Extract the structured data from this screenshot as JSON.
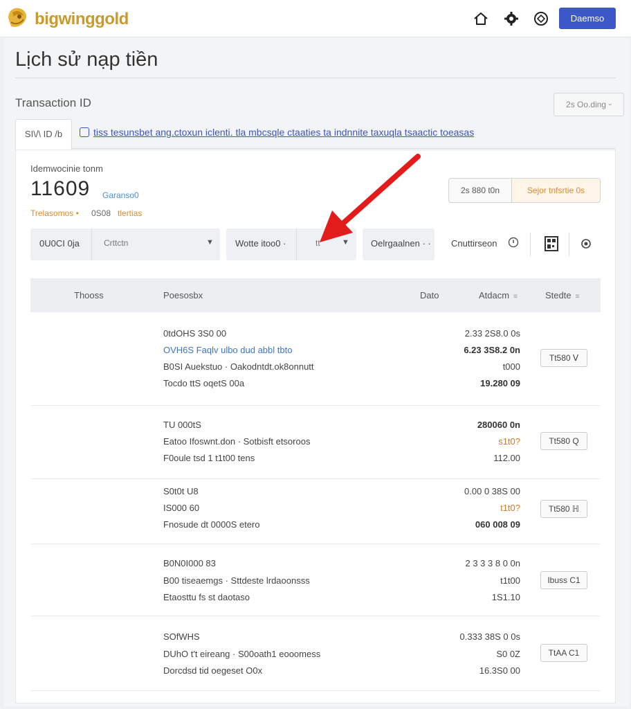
{
  "header": {
    "brand": "bigwinggold",
    "icons": [
      "home-icon",
      "settings-icon",
      "support-icon"
    ],
    "login_label": "Daemso"
  },
  "page": {
    "title": "Lịch sử nạp tiền",
    "txid_label": "Transaction ID",
    "txid_button": "2s Oo.ding ᵕ"
  },
  "tabs": {
    "active_label": "SI\\/\\ ID /b",
    "link_text": "tiss tesunsbet ang.ctoxun iclenti. tla mbcsqle ctaaties ta indnnite taxuqla tsaactic toeasas"
  },
  "balance": {
    "label": "Idemwocinie tonm",
    "value": "11609",
    "unit": "Garanso0",
    "sub_orange": "Trelasomos •",
    "sub_mid": "0S08",
    "sub_orange2": "tlertias"
  },
  "actions": {
    "grey_label": "2s 880 t0n",
    "orange_label": "Sejor tnfsrtie 0s"
  },
  "filters": {
    "date_label": "0U0CI 0ja",
    "date_value": "Crttctn",
    "method_label": "Wotte itoo0 ·",
    "method_value": "tt",
    "range_label": "Oelrgaalnen · ·",
    "search_label": "Cnuttirseon",
    "icons": [
      "info-icon",
      "qr-code-icon",
      "refresh-icon"
    ]
  },
  "table": {
    "columns": [
      "Thooss",
      "Poesosbx",
      "Dato",
      "Atdacm",
      "Stedte"
    ],
    "rows": [
      {
        "lines": [
          "0tdOHS 3S0 00",
          "OVH6S Faqlv ulbo dud abbl tbto",
          "B0SI Auekstuo  ·  Oakodntdt.ok8onnutt",
          "Tocdo ttS oqetS 00a"
        ],
        "amounts": [
          "2.33 2S8.0 0s",
          "6.23 3S8.2 0n",
          "t000",
          "19.280 09"
        ],
        "status": "Tt580 ᐯ"
      },
      {
        "lines": [
          "TU 000tS",
          "Eatoo Ifoswnt.don  ·  Sotbisft etsoroos",
          "F0oule tsd 1 t1t00 tens"
        ],
        "amounts": [
          "280060 0n",
          "s1t0?",
          "112.00"
        ],
        "status": "Tt580 Q"
      },
      {
        "lines": [
          "S0t0t U8",
          "IS000 60",
          "Fnosude dt 0000S etero"
        ],
        "amounts": [
          "0.00 0 38S 00",
          "t1t0?",
          "060 008 09"
        ],
        "status": "Tt580 ℍ"
      },
      {
        "lines": [
          "B0N0I000 83",
          "B00 tiseaemgs  ·  Sttdeste lrdaoonsss",
          "Etaosttu fs st daotaso"
        ],
        "amounts": [
          "2 3 3 3 8 0 0n",
          "t1t00",
          "1S1.10"
        ],
        "status": "Ibuss C1"
      },
      {
        "lines": [
          "SOfWHS",
          "DUhO t't eireang  ·  S00oath1 eooomess",
          "Dorcdsd tid oegeset O0x"
        ],
        "amounts": [
          "0.333 38S 0 0s",
          "S0 0Z",
          "16.3S0 00"
        ],
        "status": "TtAA C1"
      }
    ]
  },
  "colors": {
    "accent_blue": "#3e57c8",
    "brand_gold": "#c99a2c",
    "orange": "#e28a2b",
    "arrow_red": "#e21b1b"
  }
}
